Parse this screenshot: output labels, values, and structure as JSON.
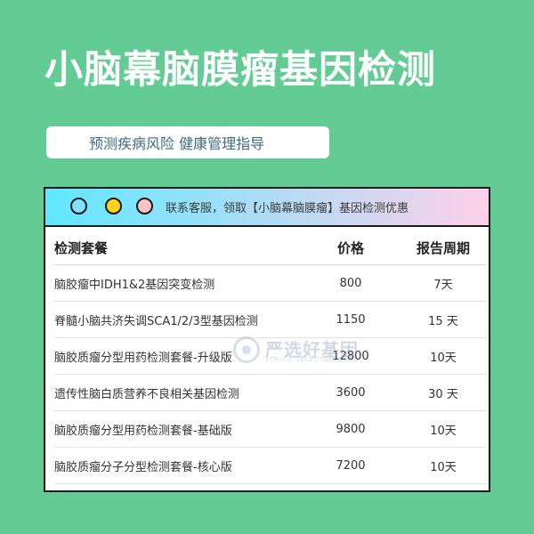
{
  "hero": {
    "title": "小脑幕脑膜瘤基因检测",
    "subtitle": "预测疾病风险 健康管理指导"
  },
  "window": {
    "contact_text": "联系客服，领取【小脑幕脑膜瘤】基因检测优惠",
    "dot_colors": [
      "#7fe3ff",
      "#ffd21f",
      "#ffc2c8"
    ]
  },
  "table": {
    "headers": [
      "检测套餐",
      "价格",
      "报告周期"
    ],
    "rows": [
      {
        "name": "脑胶瘤中IDH1&2基因突变检测",
        "price": "800",
        "period": "7天"
      },
      {
        "name": "脊髓小脑共济失调SCA1/2/3型基因检测",
        "price": "1150",
        "period": "15 天"
      },
      {
        "name": "脑胶质瘤分型用药检测套餐-升级版",
        "price": "12800",
        "period": "10天"
      },
      {
        "name": "遗传性脑白质营养不良相关基因检测",
        "price": "3600",
        "period": "30 天"
      },
      {
        "name": "脑胶质瘤分型用药检测套餐-基础版",
        "price": "9800",
        "period": "10天"
      },
      {
        "name": "脑胶质瘤分子分型检测套餐-核心版",
        "price": "7200",
        "period": "10天"
      }
    ]
  },
  "watermark": {
    "brand": "严选好基因",
    "subtext": "STRICT SELECTED GENE"
  },
  "colors": {
    "background": "#62CC94",
    "title": "#ffffff",
    "subtitle_text": "#3f6a86",
    "border": "#1a1a1a"
  }
}
